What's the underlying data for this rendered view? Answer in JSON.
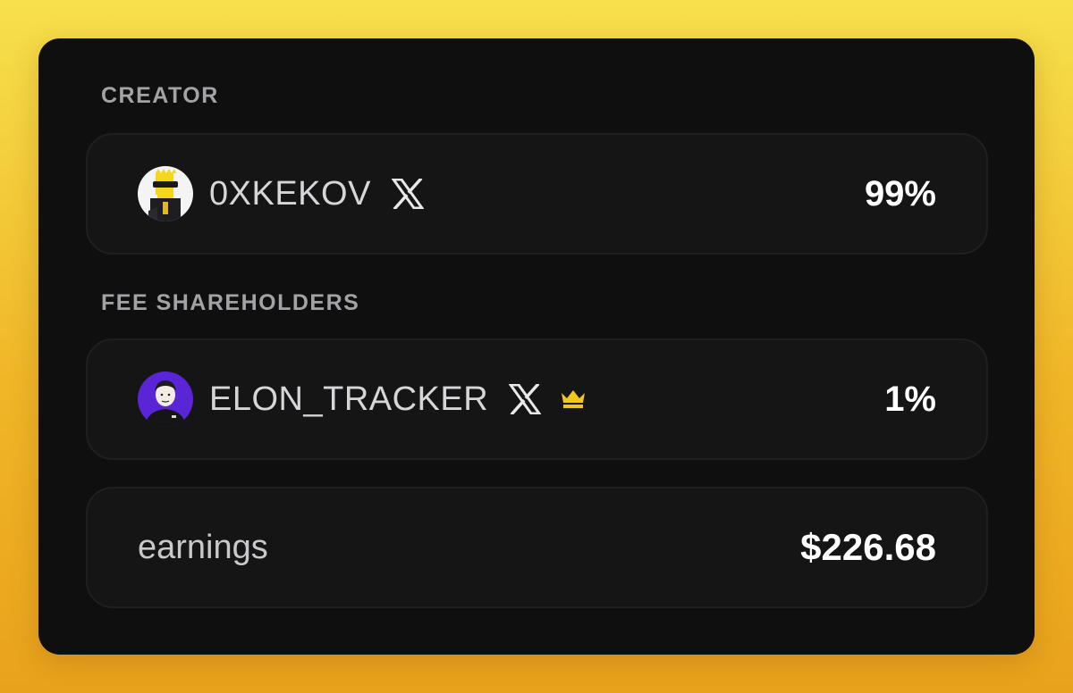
{
  "sections": {
    "creator_label": "CREATOR",
    "shareholders_label": "FEE SHAREHOLDERS"
  },
  "creator": {
    "name": "0XKEKOV",
    "share": "99%",
    "avatar_icon": "bart-avatar-icon",
    "social_icon": "x-logo-icon"
  },
  "shareholders": [
    {
      "name": "ELON_TRACKER",
      "share": "1%",
      "avatar_icon": "elon-avatar-icon",
      "social_icon": "x-logo-icon",
      "badge_icon": "crown-icon"
    }
  ],
  "earnings": {
    "label": "earnings",
    "value": "$226.68"
  },
  "colors": {
    "card_bg": "#0f0f10",
    "row_bg": "#151516",
    "crown": "#f2c71b",
    "label": "#a3a3a6"
  }
}
